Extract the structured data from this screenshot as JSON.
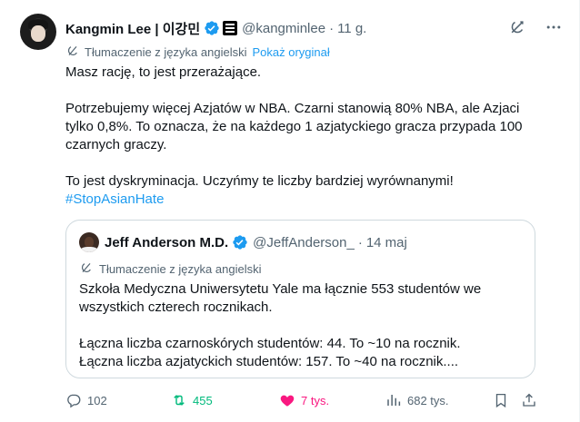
{
  "author": {
    "name": "Kangmin Lee | 이강민",
    "handle": "@kangminlee",
    "time": "11 g.",
    "separator": "·"
  },
  "translation": {
    "label": "Tłumaczenie z języka angielski",
    "show_original": "Pokaż oryginał"
  },
  "body": {
    "p1": "Masz rację, to jest przerażające.",
    "p2": "Potrzebujemy więcej Azjatów w NBA. Czarni stanowią 80% NBA, ale Azjaci tylko 0,8%. To oznacza, że na każdego 1 azjatyckiego gracza przypada 100 czarnych graczy.",
    "p3": "To jest dyskryminacja. Uczyńmy te liczby bardziej wyrównanymi!",
    "hashtag": "#StopAsianHate"
  },
  "quote": {
    "name": "Jeff Anderson M.D.",
    "handle": "@JeffAnderson_",
    "time": "14 maj",
    "separator": "·",
    "translation_label": "Tłumaczenie z języka angielski",
    "p1": "Szkoła Medyczna Uniwersytetu Yale ma łącznie 553 studentów we wszystkich czterech rocznikach.",
    "p2_line1": "Łączna liczba czarnoskórych studentów: 44. To ~10 na rocznik.",
    "p2_line2": "Łączna liczba azjatyckich studentów: 157. To ~40 na rocznik...."
  },
  "actions": {
    "replies": "102",
    "retweets": "455",
    "likes": "7 tys.",
    "views": "682 tys."
  },
  "colors": {
    "accent": "#1d9bf0",
    "retweet": "#00ba7c",
    "like": "#f91880",
    "muted": "#536471",
    "text": "#0f1419"
  },
  "icons": {
    "verified": "verified-badge-icon",
    "affiliation": "affiliation-badge-icon",
    "grok": "grok-icon",
    "more": "more-dots-icon",
    "translate": "translate-icon",
    "reply": "reply-icon",
    "retweet": "retweet-icon",
    "like": "heart-icon",
    "views": "views-chart-icon",
    "bookmark": "bookmark-icon",
    "share": "share-icon"
  }
}
